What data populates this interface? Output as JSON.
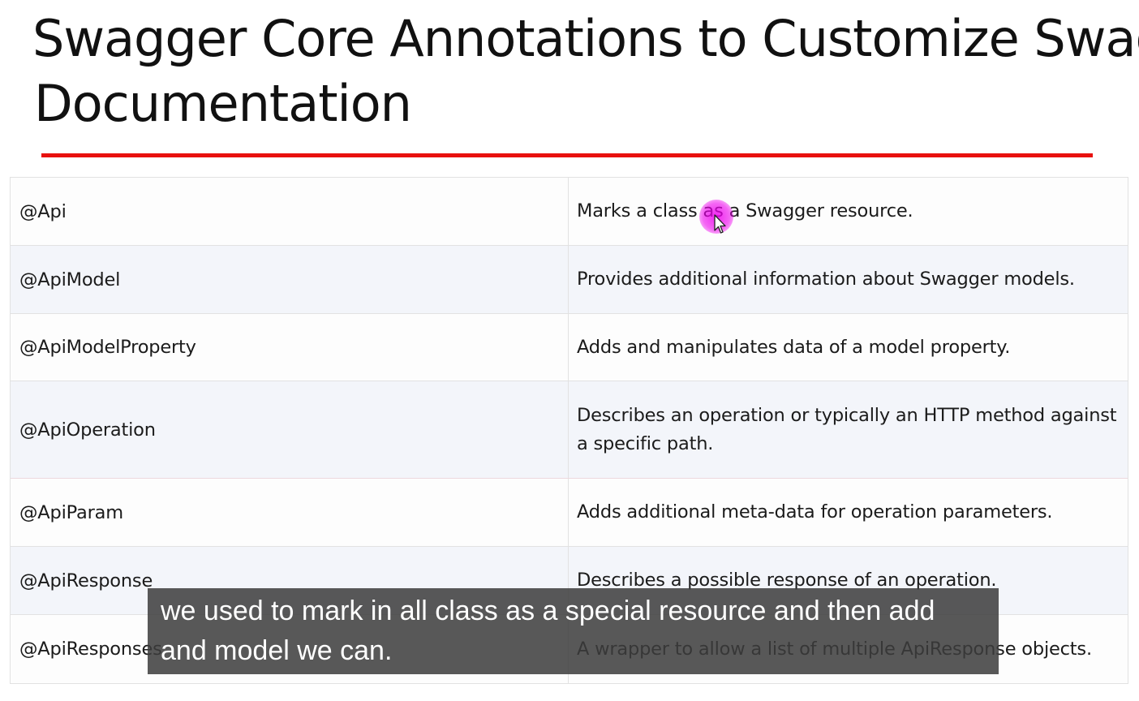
{
  "slide": {
    "title_line1": "Swagger Core Annotations to Customize Swagger",
    "title_line2": "Documentation",
    "accent_color": "#e8110f"
  },
  "annotations": [
    {
      "name": "@Api",
      "description": "Marks a class as a Swagger resource."
    },
    {
      "name": "@ApiModel",
      "description": "Provides additional information about Swagger models."
    },
    {
      "name": "@ApiModelProperty",
      "description": "Adds and manipulates data of a model property."
    },
    {
      "name": "@ApiOperation",
      "description": "Describes an operation or typically an HTTP method against a specific path."
    },
    {
      "name": "@ApiParam",
      "description": "Adds additional meta-data for operation parameters."
    },
    {
      "name": "@ApiResponse",
      "description": "Describes a possible response of an operation."
    },
    {
      "name": "@ApiResponses",
      "description": "A wrapper to allow a list of multiple ApiResponse objects."
    }
  ],
  "caption": {
    "line1": "we used to mark in all class as a special resource and then add",
    "line2": "and model we can."
  },
  "cursor": {
    "icon": "mouse-pointer-icon",
    "highlight_color": "#ee00ee"
  }
}
